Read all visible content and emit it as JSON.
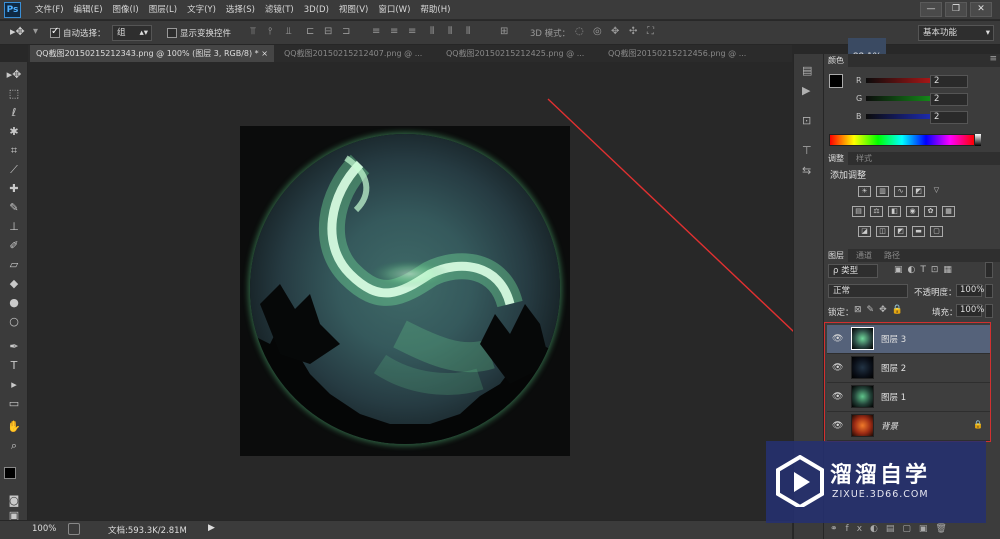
{
  "app": {
    "logo": "Ps"
  },
  "menu": [
    "文件(F)",
    "编辑(E)",
    "图像(I)",
    "图层(L)",
    "文字(Y)",
    "选择(S)",
    "滤镜(T)",
    "3D(D)",
    "视图(V)",
    "窗口(W)",
    "帮助(H)"
  ],
  "window_controls": {
    "minimize": "—",
    "restore": "❐",
    "close": "✕"
  },
  "options": {
    "auto_select_label": "自动选择：",
    "auto_select_value": "组",
    "show_transform_label": "显示变换控件",
    "mode_3d_label": "3D 模式：",
    "workspace": "基本功能"
  },
  "tabs": [
    {
      "label": "QQ截图20150215212343.png @ 100% (图层 3, RGB/8) * ×",
      "active": true
    },
    {
      "label": "QQ截图20150215212407.png @ ...",
      "active": false
    },
    {
      "label": "QQ截图20150215212425.png @ ...",
      "active": false
    },
    {
      "label": "QQ截图20150215212456.png @ ...",
      "active": false
    }
  ],
  "tooltip_zoom": "88.1%",
  "status": {
    "zoom": "100%",
    "doc_info": "文档:593.3K/2.81M"
  },
  "color_panel": {
    "tabs": [
      "颜色"
    ],
    "channels": [
      {
        "label": "R",
        "value": "2",
        "color": "#e11b1b"
      },
      {
        "label": "G",
        "value": "2",
        "color": "#18b51e"
      },
      {
        "label": "B",
        "value": "2",
        "color": "#2336e8"
      }
    ]
  },
  "adjust_panel": {
    "tabs": [
      "调整",
      "样式"
    ],
    "title": "添加调整"
  },
  "layers_panel": {
    "tabs": [
      "图层",
      "通道",
      "路径"
    ],
    "filter_label": "ρ 类型",
    "blend_mode": "正常",
    "opacity_label": "不透明度：",
    "opacity_value": "100%",
    "lock_label": "锁定：",
    "fill_label": "填充：",
    "fill_value": "100%",
    "layers": [
      {
        "name": "图层 3",
        "selected": true,
        "locked": false
      },
      {
        "name": "图层 2",
        "selected": false,
        "locked": false
      },
      {
        "name": "图层 1",
        "selected": false,
        "locked": false
      },
      {
        "name": "背景",
        "selected": false,
        "locked": true
      }
    ]
  },
  "watermark": {
    "title": "溜溜自学",
    "url": "ZIXUE.3D66.COM"
  },
  "colors": {
    "accent": "#55627a",
    "annotation": "#e03030"
  }
}
